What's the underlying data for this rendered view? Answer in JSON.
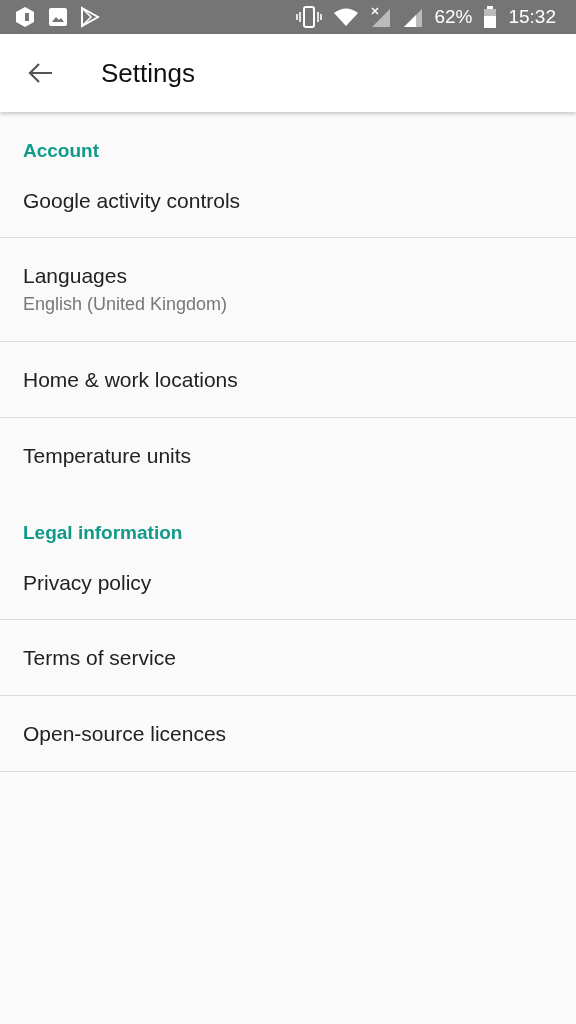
{
  "status_bar": {
    "battery": "62%",
    "time": "15:32"
  },
  "toolbar": {
    "title": "Settings"
  },
  "sections": [
    {
      "header": "Account",
      "items": [
        {
          "title": "Google activity controls"
        },
        {
          "title": "Languages",
          "subtitle": "English (United Kingdom)"
        },
        {
          "title": "Home & work locations"
        },
        {
          "title": "Temperature units"
        }
      ]
    },
    {
      "header": "Legal information",
      "items": [
        {
          "title": "Privacy policy"
        },
        {
          "title": "Terms of service"
        },
        {
          "title": "Open-source licences"
        }
      ]
    }
  ]
}
